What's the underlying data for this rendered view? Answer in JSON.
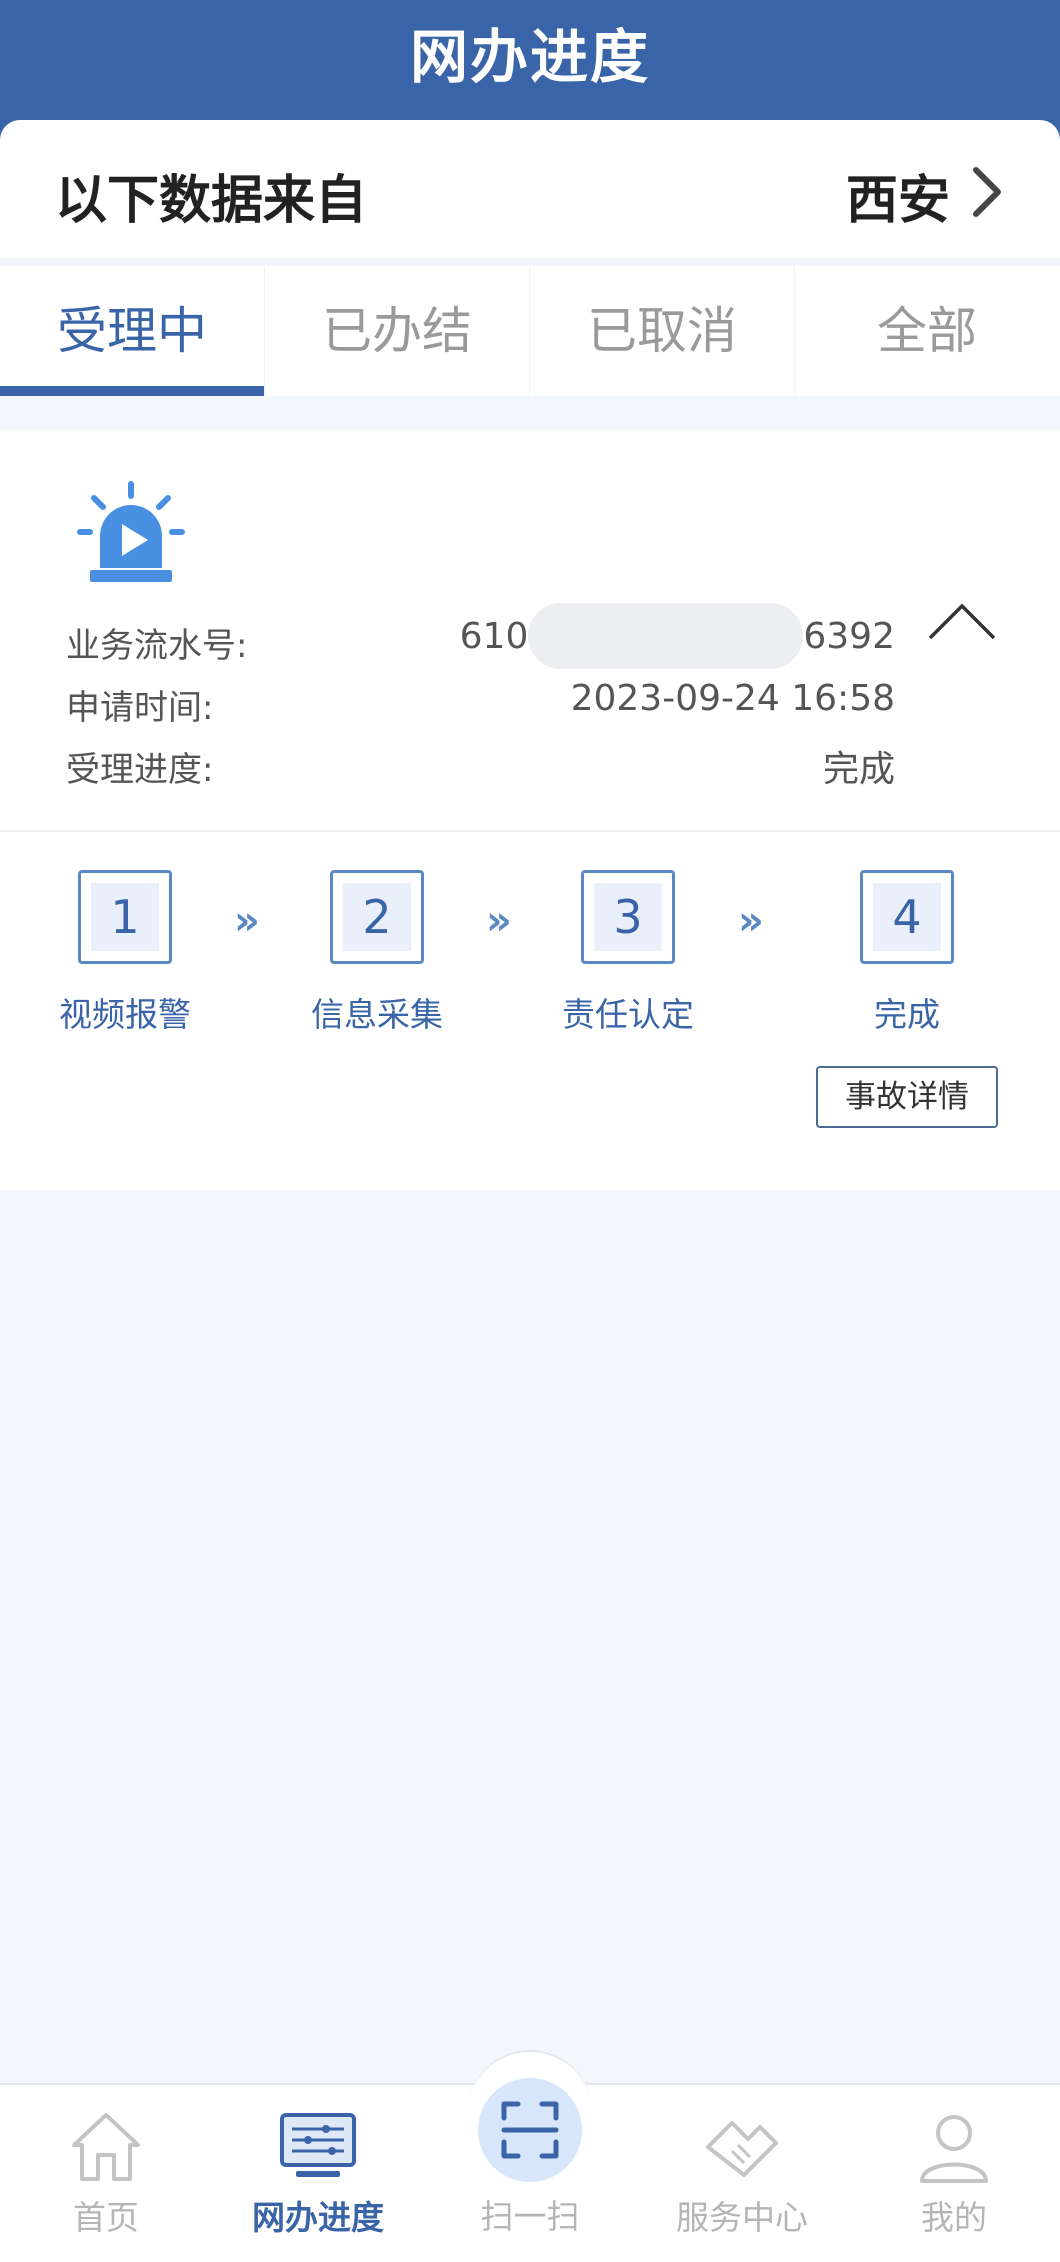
{
  "header": {
    "title": "网办进度"
  },
  "source": {
    "label": "以下数据来自",
    "city": "西安"
  },
  "tabs": [
    {
      "label": "受理中",
      "active": true
    },
    {
      "label": "已办结",
      "active": false
    },
    {
      "label": "已取消",
      "active": false
    },
    {
      "label": "全部",
      "active": false
    }
  ],
  "record": {
    "icon": "alarm-light-icon",
    "serial_label": "业务流水号:",
    "serial_prefix": "610",
    "serial_suffix": "6392",
    "time_label": "申请时间:",
    "time_value": "2023-09-24 16:58",
    "progress_label": "受理进度:",
    "progress_value": "完成",
    "steps": [
      {
        "number": "1",
        "label": "视频报警"
      },
      {
        "number": "2",
        "label": "信息采集"
      },
      {
        "number": "3",
        "label": "责任认定"
      },
      {
        "number": "4",
        "label": "完成"
      }
    ],
    "step_arrow": "»",
    "detail_button": "事故详情"
  },
  "bottom_nav": [
    {
      "label": "首页",
      "icon": "home-icon",
      "active": false
    },
    {
      "label": "网办进度",
      "icon": "monitor-icon",
      "active": true
    },
    {
      "label": "扫一扫",
      "icon": "scan-icon",
      "active": false
    },
    {
      "label": "服务中心",
      "icon": "handshake-icon",
      "active": false
    },
    {
      "label": "我的",
      "icon": "user-icon",
      "active": false
    }
  ],
  "colors": {
    "primary": "#3a64a8",
    "inactive": "#9a9a9a",
    "background": "#f3f6fa"
  }
}
